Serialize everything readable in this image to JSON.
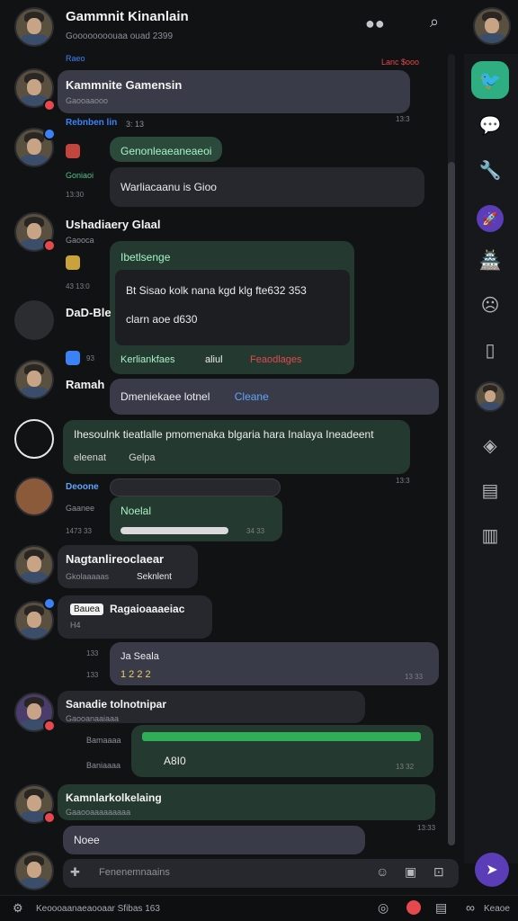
{
  "header": {
    "title": "Gammnit Kinanlain",
    "subtitle": "Goooooooouaa ouad 2399",
    "top_right_label": "Lanc $ooo"
  },
  "rail": {
    "items": [
      "twitter-icon",
      "chat-icon",
      "tool-icon",
      "rocket-icon",
      "castle-icon",
      "mask-icon",
      "bookmark-icon",
      "avatar-icon",
      "layers-icon",
      "panel-icon",
      "map-icon"
    ]
  },
  "messages": {
    "m0_label": "Raeo",
    "m1": {
      "name": "Kammnite Gamensin",
      "meta": "Gaooaaooo",
      "time": "13:3"
    },
    "m2": {
      "name": "Rebnben lin",
      "meta_time": "3: 13",
      "pill": "Genonleaeaneaeoi",
      "text": "Warliacaanu is Gioo",
      "side": "Goniaoi",
      "side_time": "13:30"
    },
    "m3": {
      "name": "Ushadiaery Glaal",
      "meta": "Gaooca",
      "box_title": "Ibetlsenge",
      "box_text1": "Bt Sisao kolk nana kgd klg fte632 353",
      "box_text2": "clarn aoe d630",
      "footer": "Kerliankfaes",
      "footer2": "aliul",
      "footer3": "Feaodlages",
      "time": "43 13:0"
    },
    "m4": {
      "name": "DaD-Ble",
      "time": "93"
    },
    "m5": {
      "name": "Ramah",
      "text": "Dmeniekaee lotnel",
      "text2": "Cleane"
    },
    "m6": {
      "text": "Ihesoulnk tieatlalle pmomenaka blgaria hara Inalaya Ineadeent",
      "sub1": "eleenat",
      "sub2": "Gelpa",
      "time": "13:3"
    },
    "m7": {
      "name": "Deoone",
      "meta": "Gaanee",
      "pill": "Noelal",
      "meta2": "1473 33",
      "time": "34 33"
    },
    "m8": {
      "name": "Nagtanlireoclaear",
      "meta": "Gkolaaaaas",
      "tag": "Seknlent"
    },
    "m9": {
      "tag": "Bauea",
      "name": "Ragaioaaaeiac",
      "sub": "H4"
    },
    "m10": {
      "meta": "133",
      "title": "Ja Seala",
      "text": "1  2 2 2",
      "time": "13 33",
      "side": "133"
    },
    "m11": {
      "name": "Sanadie tolnotnipar",
      "meta": "Gaooanaaiaaa",
      "side1": "Bamaaaa",
      "side2": "Baniaaaa",
      "text": "A8I0",
      "time": "13 32"
    },
    "m12": {
      "name": "Kamnlarkolkelaing",
      "meta": "Gaaooaaaaaaaaa",
      "text": "Noee",
      "time": "13:33"
    }
  },
  "composer": {
    "placeholder": "Fenenemnaains"
  },
  "footer": {
    "left": "Keoooaanaeaooaar Sfibas 163",
    "right": "Keaoe"
  },
  "colors": {
    "accent": "#5b3db8",
    "green": "#2fae82",
    "danger": "#e5484d"
  }
}
